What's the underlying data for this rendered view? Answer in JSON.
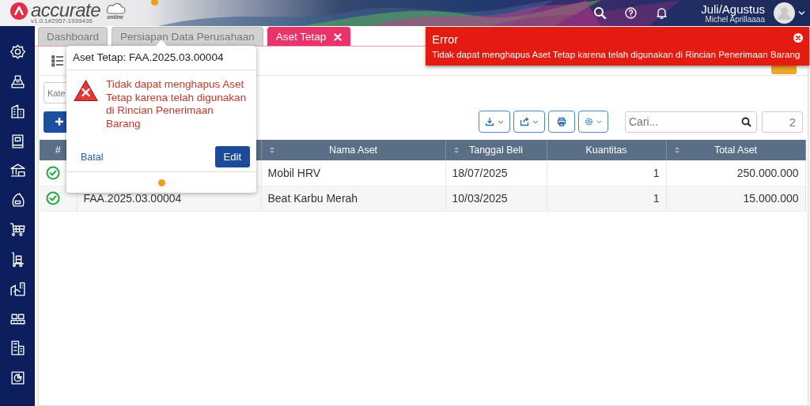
{
  "header": {
    "logo": "accurate",
    "logo_suffix": "online",
    "version": "v1.0.1#2957-1939436",
    "period": "Juli/Agustus",
    "user": "Michel Aprillaaaa"
  },
  "tabs": [
    {
      "label": "Dashboard",
      "selected": false,
      "closable": false
    },
    {
      "label": "Persiapan Data Perusahaan",
      "selected": false,
      "closable": false
    },
    {
      "label": "Aset Tetap",
      "selected": true,
      "closable": true
    }
  ],
  "filter": {
    "placeholder": "Kate"
  },
  "search": {
    "placeholder": "Cari..."
  },
  "record_count": "2",
  "table": {
    "columns": [
      {
        "label": "#",
        "sortable": false
      },
      {
        "sortable": false
      },
      {
        "label": "Nama Aset",
        "sortable": true
      },
      {
        "label": "Tanggal Beli",
        "sortable": true
      },
      {
        "label": "Kuantitas",
        "sortable": false
      },
      {
        "label": "Total Aset",
        "sortable": true
      }
    ],
    "rows": [
      {
        "name": "Mobil HRV",
        "date": "18/07/2025",
        "quantity": "1",
        "total": "250.000.000"
      },
      {
        "number": "FAA.2025.03.00004",
        "name": "Beat Karbu Merah",
        "date": "10/03/2025",
        "quantity": "1",
        "total": "15.000.000"
      }
    ]
  },
  "popup": {
    "title": "Aset Tetap: FAA.2025.03.00004",
    "message": "Tidak dapat menghapus Aset Tetap karena telah digunakan di Rincian Penerimaan Barang",
    "cancel": "Batal",
    "confirm": "Edit"
  },
  "toast": {
    "title": "Error",
    "message": "Tidak dapat menghapus Aset Tetap karena telah digunakan di Rincian Penerimaan Barang"
  }
}
